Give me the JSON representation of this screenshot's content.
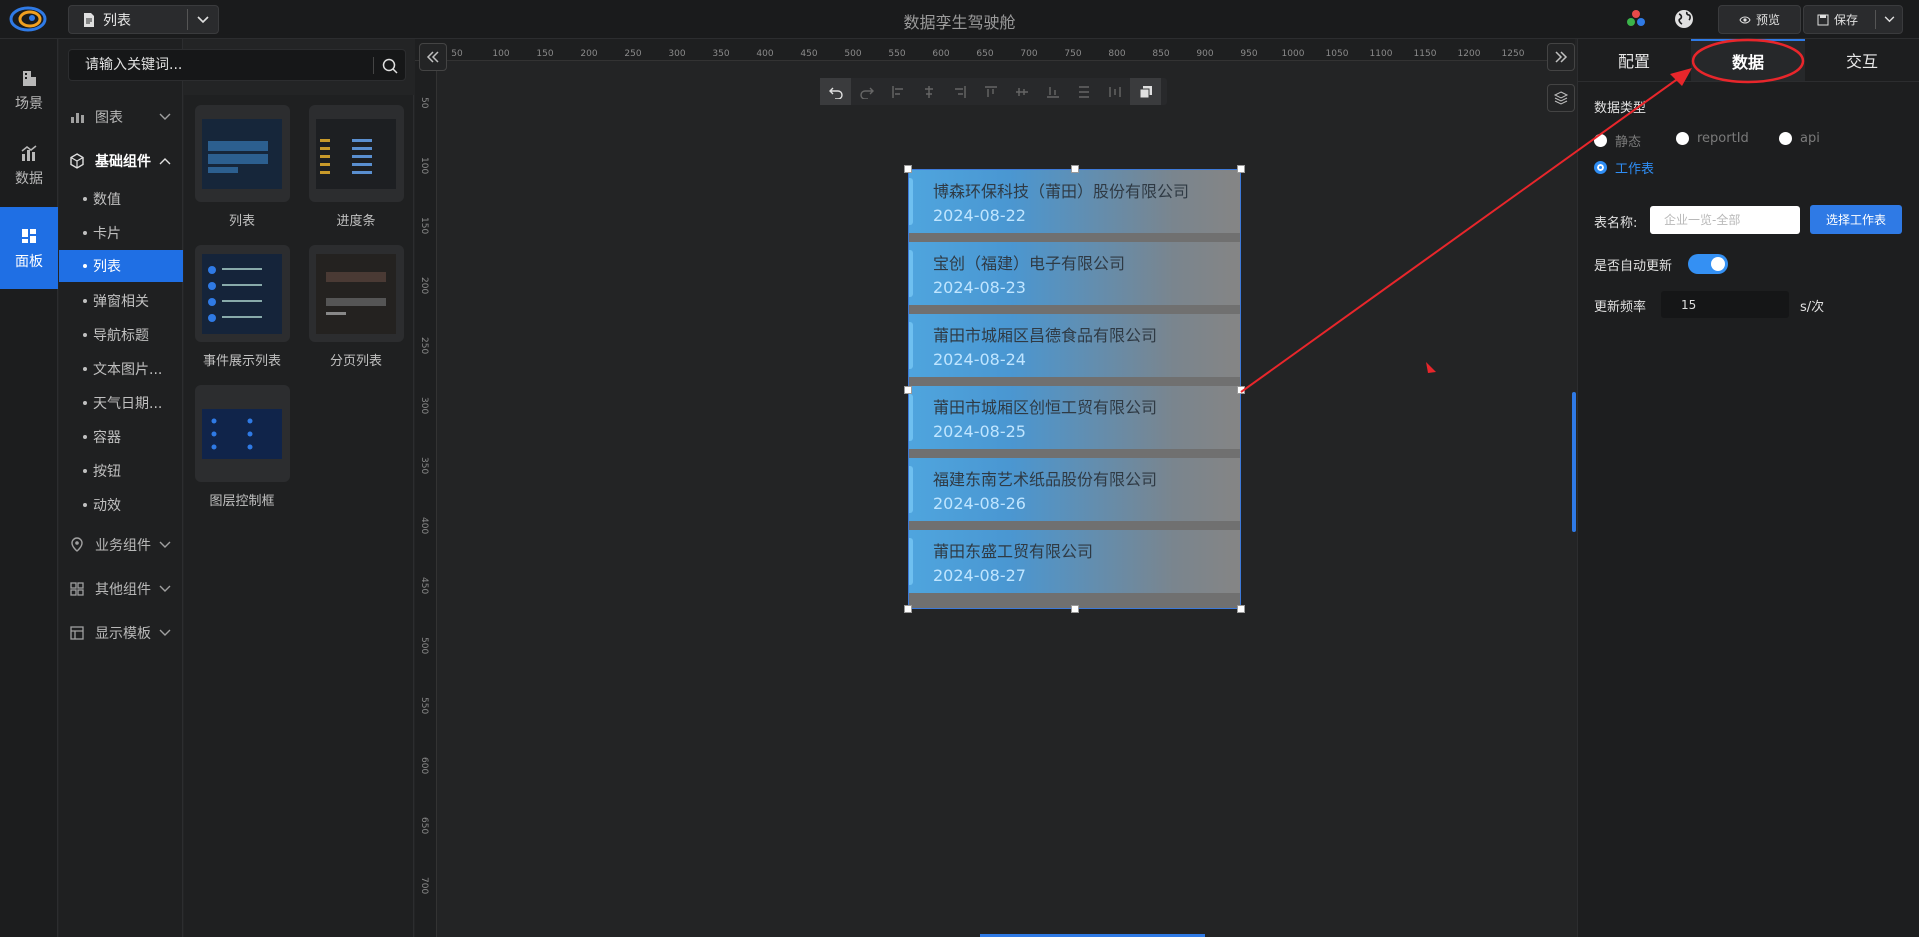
{
  "header": {
    "view_label": "列表",
    "title": "数据孪生驾驶舱",
    "preview_label": "预览",
    "save_label": "保存"
  },
  "nav": [
    {
      "label": "场景",
      "icon": "building-icon"
    },
    {
      "label": "数据",
      "icon": "chart-icon"
    },
    {
      "label": "面板",
      "icon": "grid-icon"
    }
  ],
  "search": {
    "placeholder": "请输入关键词..."
  },
  "categories": {
    "chart": "图表",
    "basic": "基础组件",
    "business": "业务组件",
    "other": "其他组件",
    "template": "显示模板",
    "basic_items": [
      "数值",
      "卡片",
      "列表",
      "弹窗相关",
      "导航标题",
      "文本图片...",
      "天气日期...",
      "容器",
      "按钮",
      "动效"
    ]
  },
  "components": [
    "列表",
    "进度条",
    "事件展示列表",
    "分页列表",
    "图层控制框"
  ],
  "ruler": {
    "top": [
      "50",
      "100",
      "150",
      "200",
      "250",
      "300",
      "350",
      "400",
      "450",
      "500",
      "550",
      "600",
      "650",
      "700",
      "750",
      "800",
      "850",
      "900",
      "950",
      "1000",
      "1050",
      "1100",
      "1150",
      "1200",
      "1250"
    ],
    "left": [
      "50",
      "100",
      "150",
      "200",
      "250",
      "300",
      "350",
      "400",
      "450",
      "500",
      "550",
      "600",
      "650",
      "700"
    ]
  },
  "list_widget": [
    {
      "name": "博森环保科技（莆田）股份有限公司",
      "date": "2024-08-22"
    },
    {
      "name": "宝创（福建）电子有限公司",
      "date": "2024-08-23"
    },
    {
      "name": "莆田市城厢区昌德食品有限公司",
      "date": "2024-08-24"
    },
    {
      "name": "莆田市城厢区创恒工贸有限公司",
      "date": "2024-08-25"
    },
    {
      "name": "福建东南艺术纸品股份有限公司",
      "date": "2024-08-26"
    },
    {
      "name": "莆田东盛工贸有限公司",
      "date": "2024-08-27"
    }
  ],
  "panel": {
    "tabs": [
      "配置",
      "数据",
      "交互"
    ],
    "data_type_label": "数据类型",
    "data_types": [
      "静态",
      "reportId",
      "api",
      "工作表"
    ],
    "selected_type": "工作表",
    "table_name_label": "表名称:",
    "table_name_placeholder": "企业一览-全部",
    "select_worksheet": "选择工作表",
    "auto_update_label": "是否自动更新",
    "auto_update": true,
    "freq_label": "更新频率",
    "freq_value": "15",
    "freq_unit": "s/次"
  },
  "colors": {
    "accent": "#2f7ae5",
    "annotation": "#e8262b"
  }
}
